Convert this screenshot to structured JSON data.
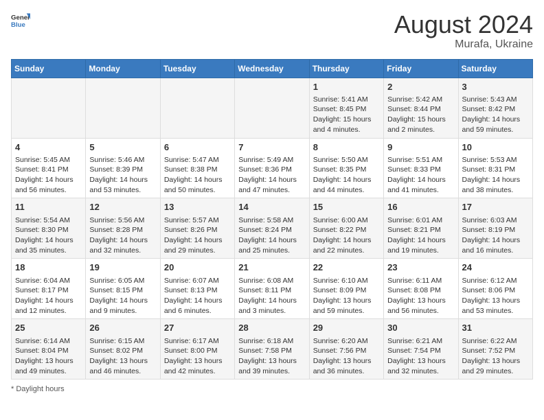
{
  "header": {
    "logo_general": "General",
    "logo_blue": "Blue",
    "month_year": "August 2024",
    "location": "Murafa, Ukraine"
  },
  "days_of_week": [
    "Sunday",
    "Monday",
    "Tuesday",
    "Wednesday",
    "Thursday",
    "Friday",
    "Saturday"
  ],
  "weeks": [
    [
      {
        "day": "",
        "sunrise": "",
        "sunset": "",
        "daylight": ""
      },
      {
        "day": "",
        "sunrise": "",
        "sunset": "",
        "daylight": ""
      },
      {
        "day": "",
        "sunrise": "",
        "sunset": "",
        "daylight": ""
      },
      {
        "day": "",
        "sunrise": "",
        "sunset": "",
        "daylight": ""
      },
      {
        "day": "1",
        "sunrise": "Sunrise: 5:41 AM",
        "sunset": "Sunset: 8:45 PM",
        "daylight": "Daylight: 15 hours and 4 minutes."
      },
      {
        "day": "2",
        "sunrise": "Sunrise: 5:42 AM",
        "sunset": "Sunset: 8:44 PM",
        "daylight": "Daylight: 15 hours and 2 minutes."
      },
      {
        "day": "3",
        "sunrise": "Sunrise: 5:43 AM",
        "sunset": "Sunset: 8:42 PM",
        "daylight": "Daylight: 14 hours and 59 minutes."
      }
    ],
    [
      {
        "day": "4",
        "sunrise": "Sunrise: 5:45 AM",
        "sunset": "Sunset: 8:41 PM",
        "daylight": "Daylight: 14 hours and 56 minutes."
      },
      {
        "day": "5",
        "sunrise": "Sunrise: 5:46 AM",
        "sunset": "Sunset: 8:39 PM",
        "daylight": "Daylight: 14 hours and 53 minutes."
      },
      {
        "day": "6",
        "sunrise": "Sunrise: 5:47 AM",
        "sunset": "Sunset: 8:38 PM",
        "daylight": "Daylight: 14 hours and 50 minutes."
      },
      {
        "day": "7",
        "sunrise": "Sunrise: 5:49 AM",
        "sunset": "Sunset: 8:36 PM",
        "daylight": "Daylight: 14 hours and 47 minutes."
      },
      {
        "day": "8",
        "sunrise": "Sunrise: 5:50 AM",
        "sunset": "Sunset: 8:35 PM",
        "daylight": "Daylight: 14 hours and 44 minutes."
      },
      {
        "day": "9",
        "sunrise": "Sunrise: 5:51 AM",
        "sunset": "Sunset: 8:33 PM",
        "daylight": "Daylight: 14 hours and 41 minutes."
      },
      {
        "day": "10",
        "sunrise": "Sunrise: 5:53 AM",
        "sunset": "Sunset: 8:31 PM",
        "daylight": "Daylight: 14 hours and 38 minutes."
      }
    ],
    [
      {
        "day": "11",
        "sunrise": "Sunrise: 5:54 AM",
        "sunset": "Sunset: 8:30 PM",
        "daylight": "Daylight: 14 hours and 35 minutes."
      },
      {
        "day": "12",
        "sunrise": "Sunrise: 5:56 AM",
        "sunset": "Sunset: 8:28 PM",
        "daylight": "Daylight: 14 hours and 32 minutes."
      },
      {
        "day": "13",
        "sunrise": "Sunrise: 5:57 AM",
        "sunset": "Sunset: 8:26 PM",
        "daylight": "Daylight: 14 hours and 29 minutes."
      },
      {
        "day": "14",
        "sunrise": "Sunrise: 5:58 AM",
        "sunset": "Sunset: 8:24 PM",
        "daylight": "Daylight: 14 hours and 25 minutes."
      },
      {
        "day": "15",
        "sunrise": "Sunrise: 6:00 AM",
        "sunset": "Sunset: 8:22 PM",
        "daylight": "Daylight: 14 hours and 22 minutes."
      },
      {
        "day": "16",
        "sunrise": "Sunrise: 6:01 AM",
        "sunset": "Sunset: 8:21 PM",
        "daylight": "Daylight: 14 hours and 19 minutes."
      },
      {
        "day": "17",
        "sunrise": "Sunrise: 6:03 AM",
        "sunset": "Sunset: 8:19 PM",
        "daylight": "Daylight: 14 hours and 16 minutes."
      }
    ],
    [
      {
        "day": "18",
        "sunrise": "Sunrise: 6:04 AM",
        "sunset": "Sunset: 8:17 PM",
        "daylight": "Daylight: 14 hours and 12 minutes."
      },
      {
        "day": "19",
        "sunrise": "Sunrise: 6:05 AM",
        "sunset": "Sunset: 8:15 PM",
        "daylight": "Daylight: 14 hours and 9 minutes."
      },
      {
        "day": "20",
        "sunrise": "Sunrise: 6:07 AM",
        "sunset": "Sunset: 8:13 PM",
        "daylight": "Daylight: 14 hours and 6 minutes."
      },
      {
        "day": "21",
        "sunrise": "Sunrise: 6:08 AM",
        "sunset": "Sunset: 8:11 PM",
        "daylight": "Daylight: 14 hours and 3 minutes."
      },
      {
        "day": "22",
        "sunrise": "Sunrise: 6:10 AM",
        "sunset": "Sunset: 8:09 PM",
        "daylight": "Daylight: 13 hours and 59 minutes."
      },
      {
        "day": "23",
        "sunrise": "Sunrise: 6:11 AM",
        "sunset": "Sunset: 8:08 PM",
        "daylight": "Daylight: 13 hours and 56 minutes."
      },
      {
        "day": "24",
        "sunrise": "Sunrise: 6:12 AM",
        "sunset": "Sunset: 8:06 PM",
        "daylight": "Daylight: 13 hours and 53 minutes."
      }
    ],
    [
      {
        "day": "25",
        "sunrise": "Sunrise: 6:14 AM",
        "sunset": "Sunset: 8:04 PM",
        "daylight": "Daylight: 13 hours and 49 minutes."
      },
      {
        "day": "26",
        "sunrise": "Sunrise: 6:15 AM",
        "sunset": "Sunset: 8:02 PM",
        "daylight": "Daylight: 13 hours and 46 minutes."
      },
      {
        "day": "27",
        "sunrise": "Sunrise: 6:17 AM",
        "sunset": "Sunset: 8:00 PM",
        "daylight": "Daylight: 13 hours and 42 minutes."
      },
      {
        "day": "28",
        "sunrise": "Sunrise: 6:18 AM",
        "sunset": "Sunset: 7:58 PM",
        "daylight": "Daylight: 13 hours and 39 minutes."
      },
      {
        "day": "29",
        "sunrise": "Sunrise: 6:20 AM",
        "sunset": "Sunset: 7:56 PM",
        "daylight": "Daylight: 13 hours and 36 minutes."
      },
      {
        "day": "30",
        "sunrise": "Sunrise: 6:21 AM",
        "sunset": "Sunset: 7:54 PM",
        "daylight": "Daylight: 13 hours and 32 minutes."
      },
      {
        "day": "31",
        "sunrise": "Sunrise: 6:22 AM",
        "sunset": "Sunset: 7:52 PM",
        "daylight": "Daylight: 13 hours and 29 minutes."
      }
    ]
  ],
  "footer": {
    "note": "Daylight hours"
  }
}
